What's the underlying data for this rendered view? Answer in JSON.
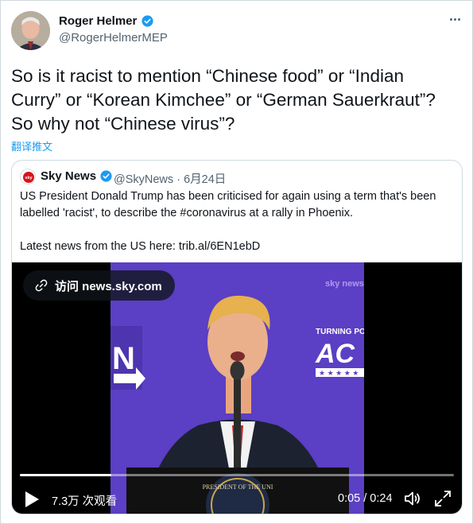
{
  "tweet": {
    "author_name": "Roger Helmer",
    "author_handle": "@RogerHelmerMEP",
    "text": "So is it racist to mention “Chinese food” or “Indian\nCurry” or “Korean Kimchee” or “German Sauerkraut”?\nSo why not “Chinese virus”?",
    "translate_label": "翻译推文",
    "verified_icon": "verified-badge-icon",
    "more_icon": "more-options-icon"
  },
  "quote": {
    "author_name": "Sky News",
    "author_handle": "@SkyNews",
    "separator": "·",
    "date": "6月24日",
    "text": "US President Donald Trump has been criticised for again using a term that's been\nlabelled 'racist', to describe the #coronavirus at a rally in Phoenix.\n\nLatest news from the US here: trib.al/6EN1ebD",
    "avatar_text": "sky"
  },
  "video": {
    "link_label": "访问 news.sky.com",
    "views": "7.3万 次观看",
    "time": "0:05 / 0:24",
    "progress": 0.21,
    "watermark": "sky news",
    "banner_text": "TURNING PO",
    "banner_big": "AC",
    "left_big": "N",
    "podium_text": "PRESIDENT OF THE UNI"
  },
  "colors": {
    "accent": "#1d9bf0",
    "text": "#0f1419",
    "muted": "#536471",
    "stage": "#5b3fc4"
  }
}
